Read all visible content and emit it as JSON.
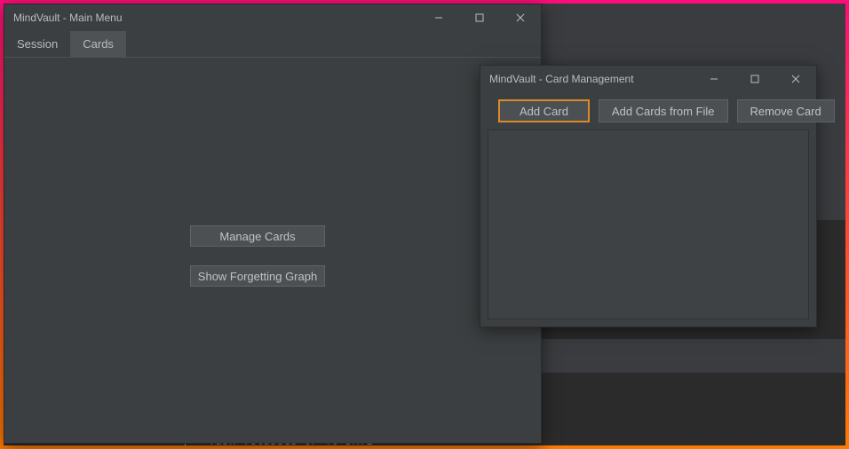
{
  "main_window": {
    "title": "MindVault - Main Menu",
    "tabs": [
      {
        "label": "Session",
        "active": false
      },
      {
        "label": "Cards",
        "active": true
      }
    ],
    "buttons": {
      "manage_cards": "Manage Cards",
      "show_graph": "Show Forgetting Graph"
    }
  },
  "card_window": {
    "title": "MindVault - Card Management",
    "buttons": {
      "add_card": "Add Card",
      "add_from_file": "Add Cards from File",
      "remove_card": "Remove Card"
    }
  },
  "console_fragment": "Task :classes UP-TO-DATE"
}
